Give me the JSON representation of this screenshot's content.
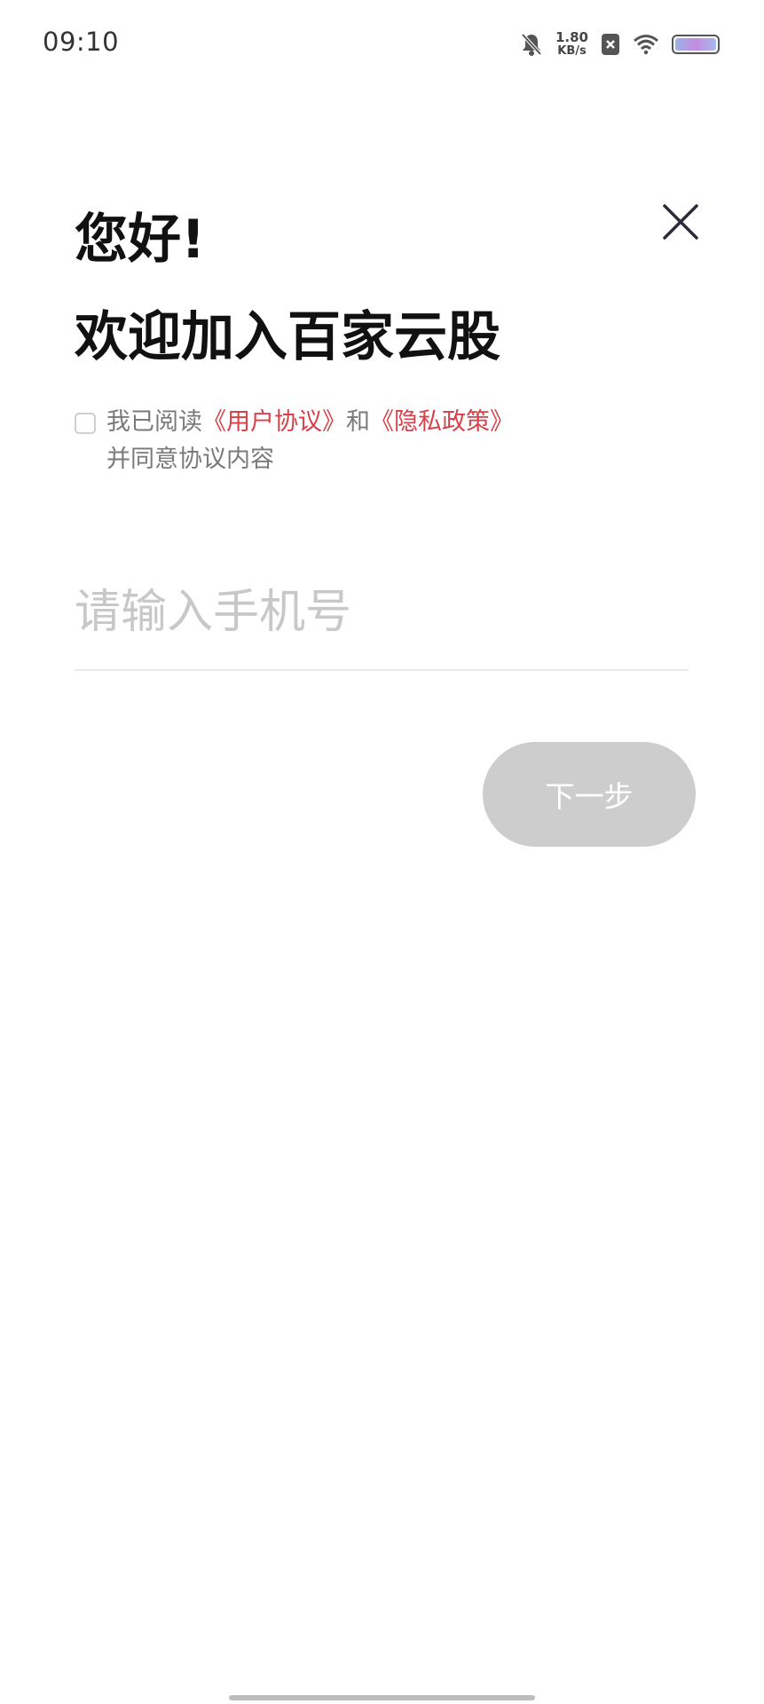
{
  "status_bar": {
    "time": "09:10",
    "net_speed_value": "1.80",
    "net_speed_unit": "KB/s",
    "icons": [
      "bell-muted-icon",
      "close-box-icon",
      "wifi-icon",
      "battery-icon"
    ]
  },
  "header": {
    "greeting": "您好!",
    "welcome": "欢迎加入百家云股",
    "close_icon": "close-icon"
  },
  "agreement": {
    "checked": false,
    "prefix": "我已阅读",
    "user_agreement": "《用户协议》",
    "connector": "和",
    "privacy_policy": "《隐私政策》",
    "suffix": "并同意协议内容"
  },
  "phone": {
    "placeholder": "请输入手机号",
    "value": ""
  },
  "next_button": {
    "label": "下一步"
  },
  "colors": {
    "link": "#d9414a",
    "button_disabled": "#cdcdcd",
    "placeholder": "#c8c8c8"
  }
}
